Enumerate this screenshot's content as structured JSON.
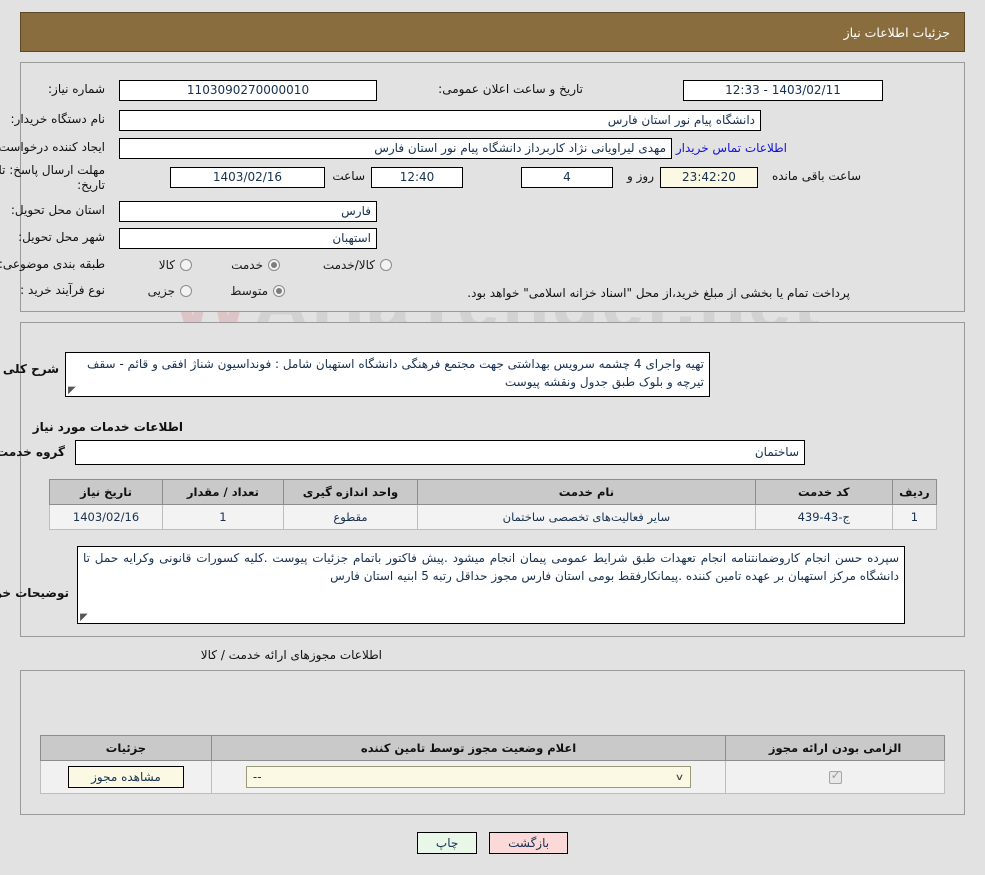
{
  "header": {
    "title": "جزئیات اطلاعات نیاز",
    "bar_color": "#8a6d3f"
  },
  "watermark": {
    "text": "AriaTender.net"
  },
  "info": {
    "need_number_label": "شماره نیاز:",
    "need_number_value": "1103090270000010",
    "announce_label": "تاریخ و ساعت اعلان عمومی:",
    "announce_value": "1403/02/11 - 12:33",
    "buyer_org_label": "نام دستگاه خریدار:",
    "buyer_org_value": "دانشگاه پیام نور استان فارس",
    "creator_label": "ایجاد کننده درخواست:",
    "creator_value": "مهدی لیراویانی نژاد کاربرداز دانشگاه پیام نور استان فارس",
    "contact_link": "اطلاعات تماس خریدار",
    "deadline_label": "مهلت ارسال پاسخ: تا تاریخ:",
    "deadline_date": "1403/02/16",
    "hour_label": "ساعت",
    "deadline_time": "12:40",
    "days_value": "4",
    "days_word": "روز و",
    "countdown_value": "23:42:20",
    "remaining_label": "ساعت باقی مانده",
    "province_label": "استان محل تحویل:",
    "province_value": "فارس",
    "city_label": "شهر محل تحویل:",
    "city_value": "استهبان",
    "category_label": "طبقه بندی موضوعی:",
    "category_options": [
      {
        "label": "کالا",
        "selected": false
      },
      {
        "label": "خدمت",
        "selected": true
      },
      {
        "label": "کالا/خدمت",
        "selected": false
      }
    ],
    "process_label": "نوع فرآیند خرید :",
    "process_options": [
      {
        "label": "جزیی",
        "selected": false
      },
      {
        "label": "متوسط",
        "selected": true
      }
    ],
    "treasury_note": "پرداخت تمام یا بخشی از مبلغ خرید،از محل \"اسناد خزانه اسلامی\" خواهد بود."
  },
  "description": {
    "label": "شرح کلی نیاز:",
    "value": "تهیه واجرای 4 چشمه سرویس بهداشتی جهت مجتمع فرهنگی دانشگاه استهبان شامل : فونداسیون شناژ افقی و قائم - سقف تیرچه و بلوک طبق جدول ونقشه پیوست"
  },
  "services": {
    "section_title": "اطلاعات خدمات مورد نیاز",
    "group_label": "گروه خدمت:",
    "group_value": "ساختمان",
    "columns": [
      "ردیف",
      "کد خدمت",
      "نام خدمت",
      "واحد اندازه گیری",
      "تعداد / مقدار",
      "تاریخ نیاز"
    ],
    "rows": [
      {
        "radif": "1",
        "code": "ج-43-439",
        "name": "سایر فعالیت‌های تخصصی ساختمان",
        "unit": "مقطوع",
        "qty": "1",
        "date": "1403/02/16"
      }
    ]
  },
  "buyer_notes": {
    "label": "توضیحات خریدار:",
    "value": "سپرده حسن انجام کاروضمانتنامه انجام تعهدات طبق شرایط عمومی پیمان انجام میشود .پیش فاکتور باتمام جزئیات پیوست .کلیه کسورات قانونی وکرایه حمل تا دانشگاه مرکز استهبان بر عهده تامین کننده .پیمانکارفقط بومی استان فارس مجوز حداقل رتبه 5 ابنیه استان فارس"
  },
  "permits": {
    "section_title": "اطلاعات مجوزهای ارائه خدمت / کالا",
    "columns": [
      "الزامی بودن ارائه مجوز",
      "اعلام وضعیت مجوز توسط تامین کننده",
      "جزئیات"
    ],
    "rows": [
      {
        "required_checked": true,
        "status_value": "--",
        "details_button": "مشاهده مجوز"
      }
    ]
  },
  "footer": {
    "print_label": "چاپ",
    "back_label": "بازگشت"
  }
}
